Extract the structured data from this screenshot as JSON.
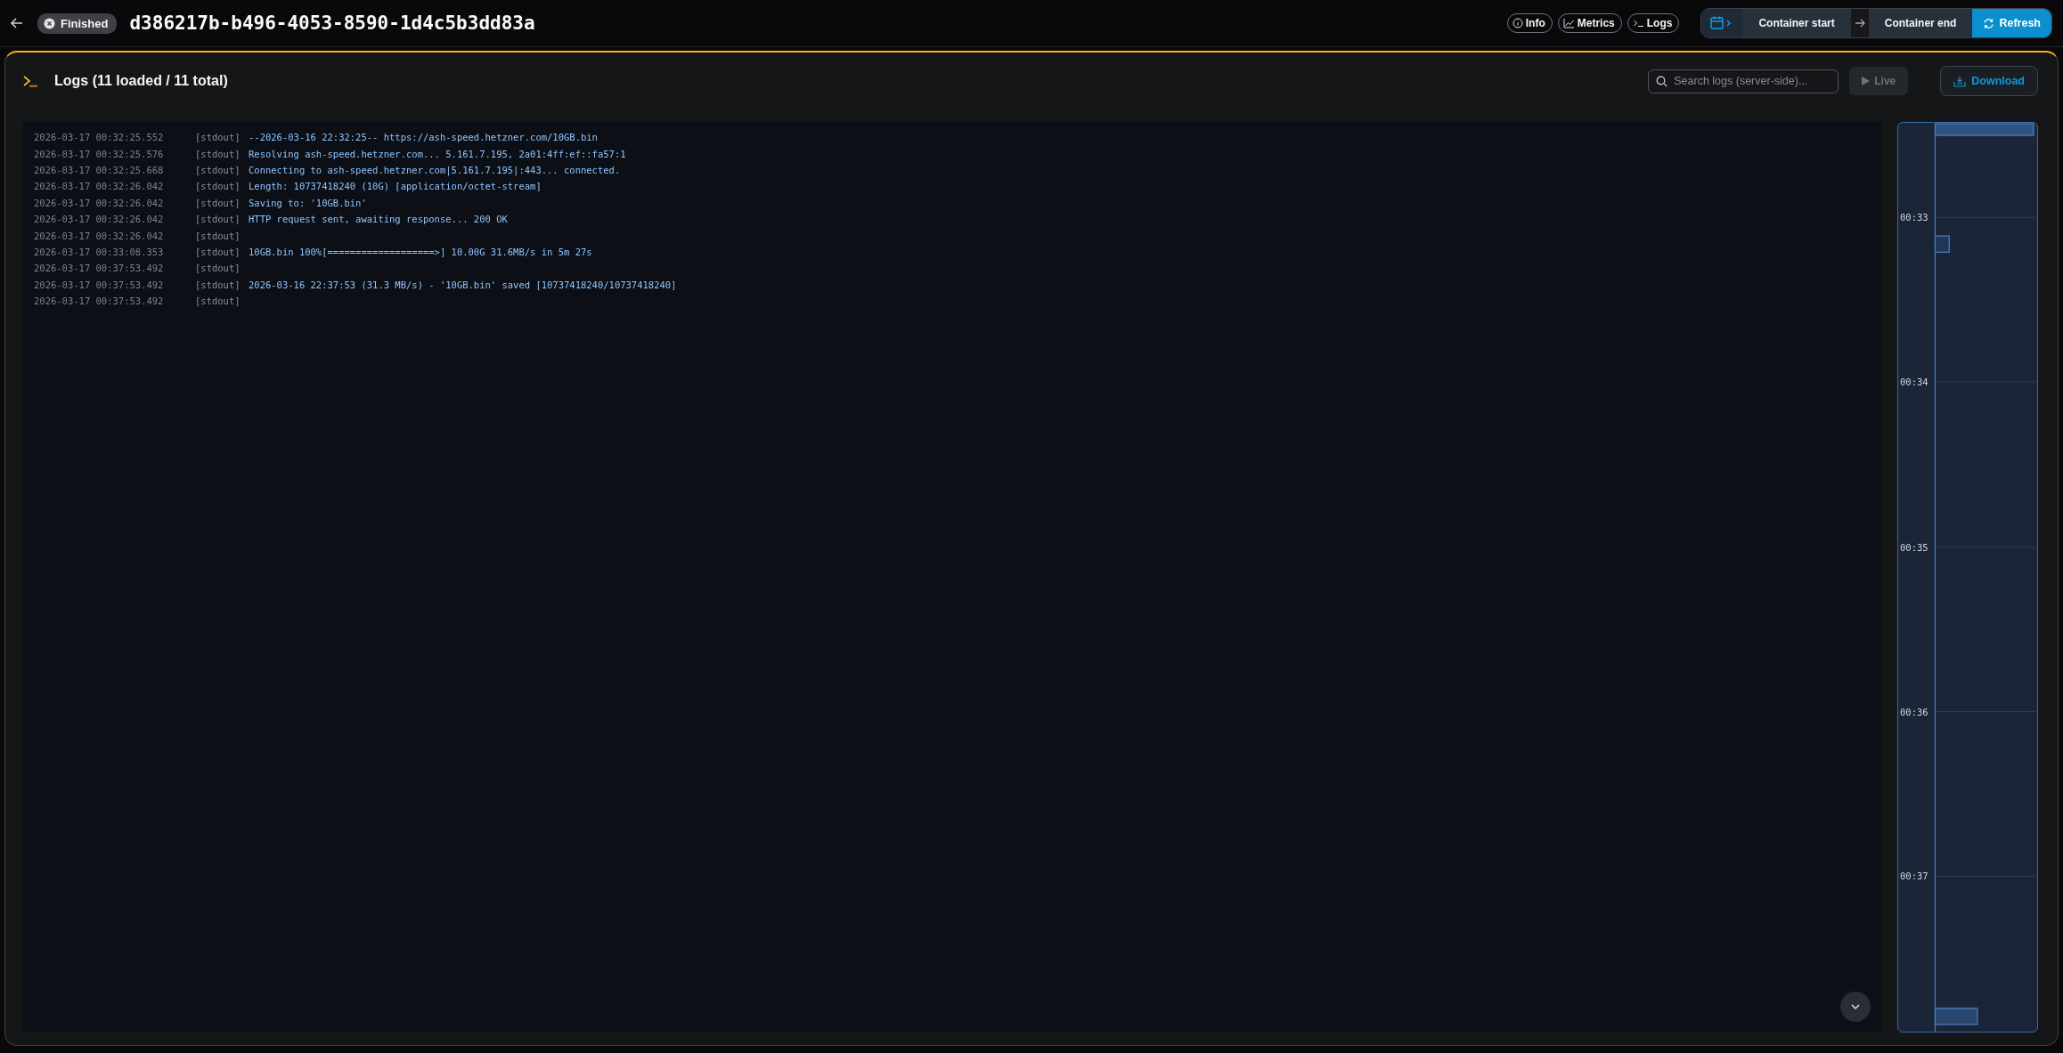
{
  "header": {
    "status": "Finished",
    "title": "d386217b-b496-4053-8590-1d4c5b3dd83a",
    "views": [
      {
        "label": "Info",
        "kind": "info"
      },
      {
        "label": "Metrics",
        "kind": "chart"
      },
      {
        "label": "Logs",
        "kind": "terminal"
      }
    ],
    "range": {
      "start": "Container start",
      "end": "Container end",
      "refresh": "Refresh"
    }
  },
  "logs_panel": {
    "title": "Logs (11 loaded / 11 total)",
    "search": {
      "placeholder": "Search logs (server-side)..."
    },
    "live": {
      "label": "Live",
      "disabled": true
    },
    "download": "Download",
    "lines": [
      {
        "time": "2026-03-17 00:32:25.552",
        "stream": "[stdout]",
        "message": "--2026-03-16 22:32:25-- https://ash-speed.hetzner.com/10GB.bin"
      },
      {
        "time": "2026-03-17 00:32:25.576",
        "stream": "[stdout]",
        "message": "Resolving ash-speed.hetzner.com... 5.161.7.195, 2a01:4ff:ef::fa57:1"
      },
      {
        "time": "2026-03-17 00:32:25.668",
        "stream": "[stdout]",
        "message": "Connecting to ash-speed.hetzner.com|5.161.7.195|:443... connected."
      },
      {
        "time": "2026-03-17 00:32:26.042",
        "stream": "[stdout]",
        "message": "Length: 10737418240 (10G) [application/octet-stream]"
      },
      {
        "time": "2026-03-17 00:32:26.042",
        "stream": "[stdout]",
        "message": "Saving to: '10GB.bin'"
      },
      {
        "time": "2026-03-17 00:32:26.042",
        "stream": "[stdout]",
        "message": "HTTP request sent, awaiting response... 200 OK"
      },
      {
        "time": "2026-03-17 00:32:26.042",
        "stream": "[stdout]"
      },
      {
        "time": "2026-03-17 00:33:08.353",
        "stream": "[stdout]",
        "message": "10GB.bin 100%[===================>] 10.00G 31.6MB/s in 5m 27s"
      },
      {
        "time": "2026-03-17 00:37:53.492",
        "stream": "[stdout]"
      },
      {
        "time": "2026-03-17 00:37:53.492",
        "stream": "[stdout]",
        "message": "2026-03-16 22:37:53 (31.3 MB/s) - '10GB.bin' saved [10737418240/10737418240]"
      },
      {
        "time": "2026-03-17 00:37:53.492",
        "stream": "[stdout]"
      }
    ],
    "timeline": {
      "ticks": [
        "00:33",
        "00:34",
        "00:35",
        "00:36",
        "00:37"
      ]
    }
  }
}
